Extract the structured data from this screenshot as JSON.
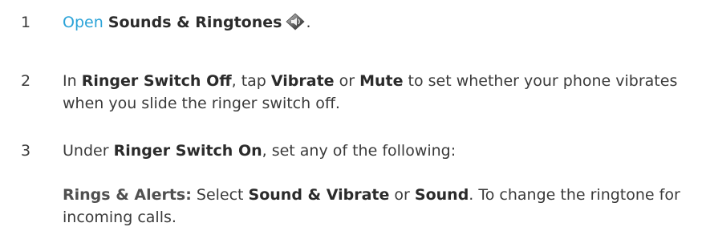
{
  "steps": [
    {
      "number": "1",
      "link": "Open",
      "app": "Sounds & Ringtones",
      "after_icon": "."
    },
    {
      "number": "2",
      "t1": "In ",
      "b1": "Ringer Switch Off",
      "t2": ", tap ",
      "b2": "Vibrate",
      "t3": " or ",
      "b3": "Mute",
      "t4": " to set whether your phone vibrates when you slide the ringer switch off."
    },
    {
      "number": "3",
      "t1": "Under ",
      "b1": "Ringer Switch On",
      "t2": ", set any of the following:"
    }
  ],
  "sub_item": {
    "b1": "Rings & Alerts:",
    "t1": " Select ",
    "b2": "Sound & Vibrate",
    "t2": " or ",
    "b3": "Sound",
    "t3": ". To change the ringtone for incoming calls."
  },
  "icons": {
    "sounds_app": "speaker-icon"
  }
}
